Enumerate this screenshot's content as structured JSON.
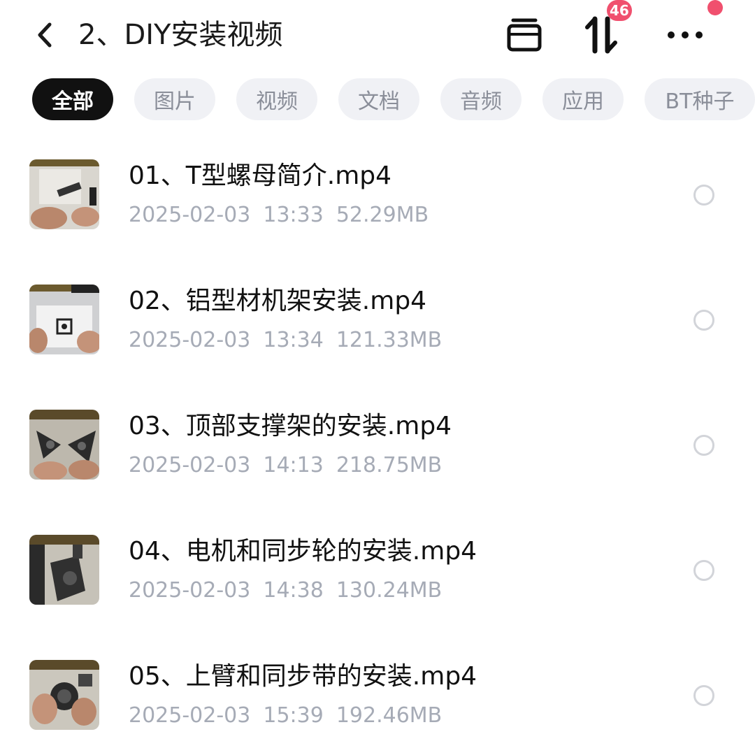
{
  "header": {
    "title": "2、DIY安装视频",
    "badge_count": "46",
    "icons": [
      "back-chevron-icon",
      "archive-box-icon",
      "sort-arrows-icon",
      "more-dots-icon"
    ]
  },
  "tabs": [
    {
      "label": "全部",
      "active": true
    },
    {
      "label": "图片",
      "active": false
    },
    {
      "label": "视频",
      "active": false
    },
    {
      "label": "文档",
      "active": false
    },
    {
      "label": "音频",
      "active": false
    },
    {
      "label": "应用",
      "active": false
    },
    {
      "label": "BT种子",
      "active": false
    }
  ],
  "files": [
    {
      "name": "01、T型螺母简介.mp4",
      "date": "2025-02-03",
      "time": "13:33",
      "size": "52.29MB",
      "selected": false
    },
    {
      "name": "02、铝型材机架安装.mp4",
      "date": "2025-02-03",
      "time": "13:34",
      "size": "121.33MB",
      "selected": false
    },
    {
      "name": "03、顶部支撑架的安装.mp4",
      "date": "2025-02-03",
      "time": "14:13",
      "size": "218.75MB",
      "selected": false
    },
    {
      "name": "04、电机和同步轮的安装.mp4",
      "date": "2025-02-03",
      "time": "14:38",
      "size": "130.24MB",
      "selected": false
    },
    {
      "name": "05、上臂和同步带的安装.mp4",
      "date": "2025-02-03",
      "time": "15:39",
      "size": "192.46MB",
      "selected": false
    }
  ],
  "colors": {
    "accent_badge": "#f0506e",
    "tab_active_bg": "#111111",
    "tab_bg": "#f0f1f5",
    "meta_text": "#a6abb6"
  }
}
